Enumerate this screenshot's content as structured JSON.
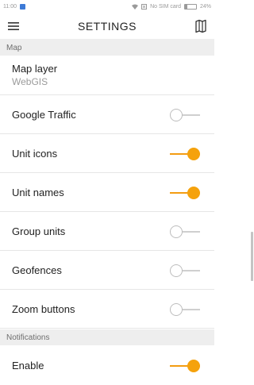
{
  "status_bar": {
    "time": "11:00",
    "carrier": "No SIM card",
    "battery_percent": "24%",
    "battery_level": 0.24
  },
  "app_bar": {
    "title": "SETTINGS",
    "menu_icon": "hamburger-menu-icon",
    "map_icon": "map-icon"
  },
  "sections": {
    "map": "Map",
    "notifications": "Notifications"
  },
  "settings": {
    "map_layer": {
      "label": "Map layer",
      "value": "WebGIS"
    },
    "google_traffic": {
      "label": "Google Traffic",
      "enabled": false
    },
    "unit_icons": {
      "label": "Unit icons",
      "enabled": true
    },
    "unit_names": {
      "label": "Unit names",
      "enabled": true
    },
    "group_units": {
      "label": "Group units",
      "enabled": false
    },
    "geofences": {
      "label": "Geofences",
      "enabled": false
    },
    "zoom_buttons": {
      "label": "Zoom buttons",
      "enabled": false
    },
    "enable": {
      "label": "Enable",
      "enabled": true
    }
  },
  "colors": {
    "accent": "#f5a20c",
    "section_bg": "#eeeeee"
  }
}
